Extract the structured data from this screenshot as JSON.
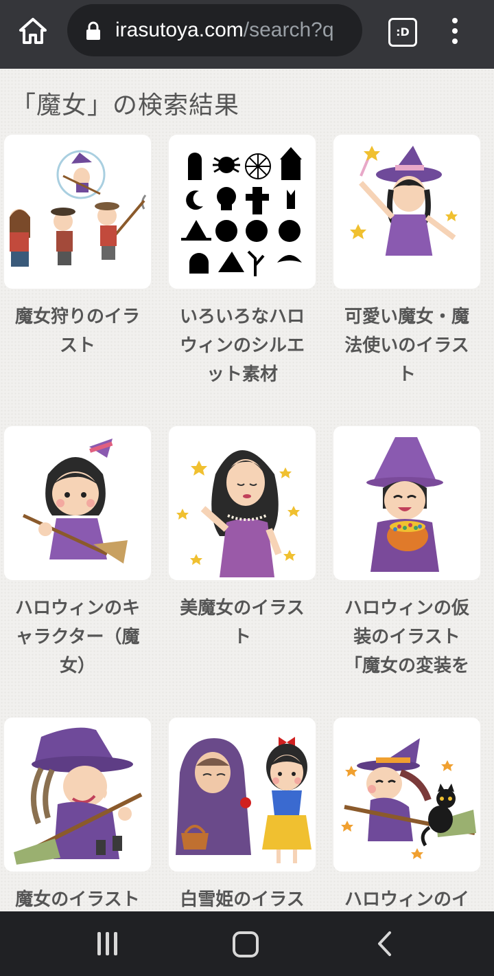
{
  "browser": {
    "url_host": "irasutoya.com",
    "url_path": "/search?q",
    "tab_switcher_label": ":D",
    "icons": [
      "home-icon",
      "lock-icon",
      "tab-switcher-icon",
      "more-vert-icon"
    ]
  },
  "page": {
    "title": "「魔女」の検索結果"
  },
  "results": [
    {
      "caption": "魔女狩りのイラ\nスト",
      "image": "witch-hunt-illustration"
    },
    {
      "caption": "いろいろなハロ\nウィンのシルエ\nット素材",
      "image": "halloween-silhouettes-illustration"
    },
    {
      "caption": "可愛い魔女・魔\n法使いのイラス\nト",
      "image": "cute-witch-illustration"
    },
    {
      "caption": "ハロウィンのキ\nャラクター（魔\n女）",
      "image": "halloween-witch-character-illustration"
    },
    {
      "caption": "美魔女のイラス\nト",
      "image": "beautiful-witch-illustration"
    },
    {
      "caption": "ハロウィンの仮\n装のイラスト\n「魔女の変装を",
      "image": "witch-costume-illustration"
    },
    {
      "caption": "魔女のイラスト",
      "image": "witch-on-broom-illustration"
    },
    {
      "caption": "白雪姫のイラス",
      "image": "snow-white-illustration"
    },
    {
      "caption": "ハロウィンのイ",
      "image": "halloween-witch-cat-illustration"
    }
  ],
  "nav_bar": {
    "icons": [
      "recent-apps-icon",
      "home-circle-icon",
      "back-icon"
    ]
  },
  "colors": {
    "toolbar": "#35363a",
    "omnibox": "#202124",
    "page_bg": "#f1f0ee",
    "witch_purple": "#6f4a9a",
    "caption_text": "#555555"
  }
}
